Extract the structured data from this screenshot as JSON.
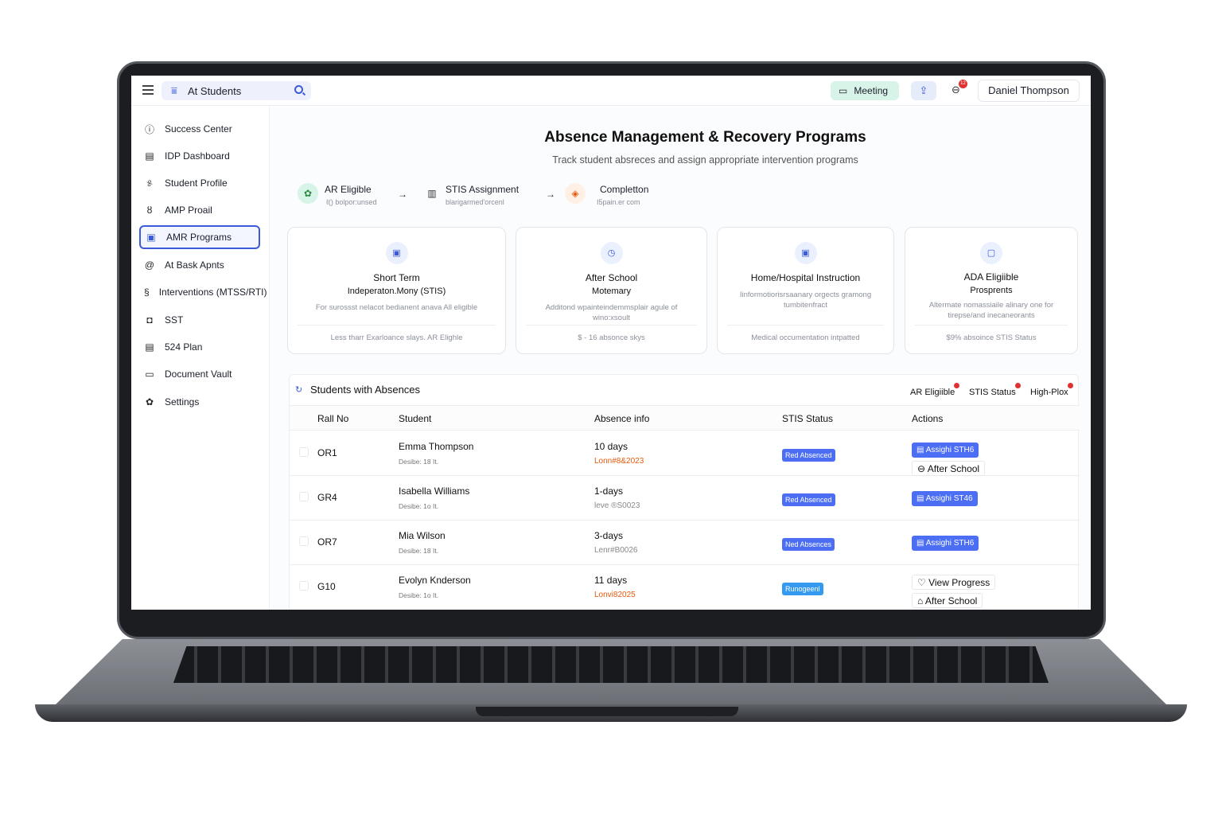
{
  "topbar": {
    "search_value": "At Students",
    "meeting_label": "Meeting",
    "notification_count": "12",
    "user_name": "Daniel Thompson"
  },
  "sidebar": {
    "items": [
      {
        "label": "Success Center",
        "icon": "info-icon"
      },
      {
        "label": "IDP Dashboard",
        "icon": "document-icon"
      },
      {
        "label": "Student Profile",
        "icon": "person-icon"
      },
      {
        "label": "AMP Proail",
        "icon": "people-icon"
      },
      {
        "label": "AMR Programs",
        "icon": "document-icon",
        "active": true
      },
      {
        "label": "At Bask Apnts",
        "icon": "at-icon"
      },
      {
        "label": "Interventions (MTSS/RTI)",
        "icon": "link-icon"
      },
      {
        "label": "SST",
        "icon": "box-icon"
      },
      {
        "label": "524 Plan",
        "icon": "document-icon"
      },
      {
        "label": "Document Vault",
        "icon": "folder-icon"
      },
      {
        "label": "Settings",
        "icon": "gear-icon"
      }
    ]
  },
  "header": {
    "title": "Absence Management & Recovery Programs",
    "subtitle": "Track student absreces and assign appropriate intervention programs"
  },
  "steps": [
    {
      "label": "AR Eligible",
      "sub": "ℓ() bolpor:unsed"
    },
    {
      "label": "STIS Assignment",
      "sub": "blarigarmed'orcenl"
    },
    {
      "label": "Completton",
      "sub": "I5pain.er com"
    }
  ],
  "cards": [
    {
      "title": "Short Term",
      "subtitle": "Indeperaton.Mony (STIS)",
      "desc": "For surossst nelacot bedianent anava All eligible",
      "footer": "Less tharr Exarloance slays. AR Elighle"
    },
    {
      "title": "After School",
      "subtitle": "Motemary",
      "desc": "Additond wpainteindemmsplair agule of wino:xsoult",
      "footer": "$ - 16 absonce skys"
    },
    {
      "title": "Home/Hospital Instruction",
      "subtitle": "",
      "desc": "Iinformotiorisrsaanary orgects gramong tumbitenfract",
      "footer": "Medical occumentation intpatted"
    },
    {
      "title": "ADA Eligiible",
      "subtitle": "Prosprents",
      "desc": "Altermate nomassiaile alinary one for tirepse/and inecaneorants",
      "footer": "$9% absoince STIS Status"
    }
  ],
  "table": {
    "title": "Students with Absences",
    "filters": [
      "AR Eligiible",
      "STIS Status",
      "High-Plox"
    ],
    "columns": [
      "Rall No",
      "Student",
      "Absence info",
      "STIS Status",
      "Actions"
    ],
    "rows": [
      {
        "roll": "OR1",
        "name": "Emma Thompson",
        "meta": "Desibe:  18  It.",
        "days": "10 days",
        "date": "Lonn#8&2023",
        "status": "Red Absenced",
        "actions": [
          "Assighi STH6",
          "After School"
        ]
      },
      {
        "roll": "GR4",
        "name": "Isabella Williams",
        "meta": "Desibe:  1o  It.",
        "days": "1-days",
        "date": "leve ®S0023",
        "status": "Red Absenced",
        "actions": [
          "Assighi ST46"
        ]
      },
      {
        "roll": "OR7",
        "name": "Mia Wilson",
        "meta": "Desibe:  18  It.",
        "days": "3-days",
        "date": "Lenr#B0026",
        "status": "Ned Absences",
        "actions": [
          "Assighi STH6"
        ]
      },
      {
        "roll": "G10",
        "name": "Evolyn Knderson",
        "meta": "Desibe:  1o  It.",
        "days": "11 days",
        "date": "Lonvi82025",
        "status": "Runogeenl",
        "actions": [
          "View Progress",
          "After School"
        ]
      }
    ]
  }
}
